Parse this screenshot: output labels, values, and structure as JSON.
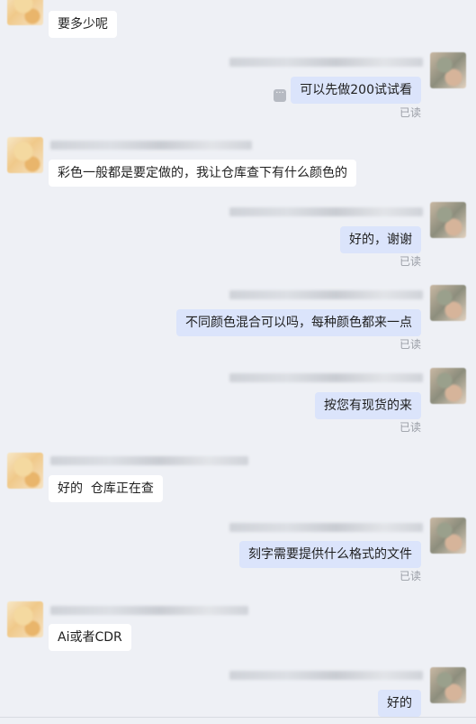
{
  "messages": [
    {
      "side": "left",
      "text": "要多少呢"
    },
    {
      "side": "right",
      "text": "可以先做200试试看",
      "status": "已读"
    },
    {
      "side": "left",
      "text": "彩色一般都是要定做的，我让仓库查下有什么颜色的"
    },
    {
      "side": "right",
      "text": "好的，谢谢",
      "status": "已读"
    },
    {
      "side": "right",
      "text": "不同颜色混合可以吗，每种颜色都来一点",
      "status": "已读"
    },
    {
      "side": "right",
      "text": "按您有现货的来",
      "status": "已读"
    },
    {
      "side": "left",
      "text": "好的  仓库正在查"
    },
    {
      "side": "right",
      "text": "刻字需要提供什么格式的文件",
      "status": "已读"
    },
    {
      "side": "left",
      "text": "Ai或者CDR"
    },
    {
      "side": "right",
      "text": "好的"
    }
  ],
  "icons": {
    "more": "ellipsis-icon",
    "more_glyph": "···"
  }
}
